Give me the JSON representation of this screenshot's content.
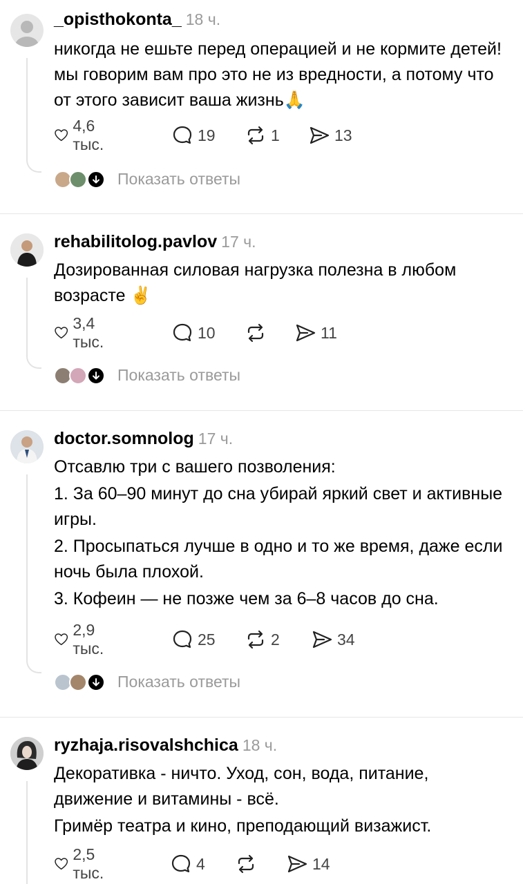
{
  "posts": [
    {
      "username": "_opisthokonta_",
      "time": "18 ч.",
      "paragraphs": [
        "никогда не ешьте перед операцией и не кормите детей! мы говорим вам про это не из вредности, а потому что от этого зависит ваша жизнь🙏"
      ],
      "likes": "4,6 тыс.",
      "comments": "19",
      "reposts": "1",
      "shares": "13",
      "show_replies": "Показать ответы"
    },
    {
      "username": "rehabilitolog.pavlov",
      "time": "17 ч.",
      "paragraphs": [
        "Дозированная силовая нагрузка полезна в любом возрасте ✌️"
      ],
      "likes": "3,4 тыс.",
      "comments": "10",
      "reposts": "",
      "shares": "11",
      "show_replies": "Показать ответы"
    },
    {
      "username": "doctor.somnolog",
      "time": "17 ч.",
      "paragraphs": [
        "Отсавлю три с вашего позволения:",
        "1. За 60–90 минут до сна убирай яркий свет и активные игры.",
        "2. Просыпаться лучше в одно и то же время, даже если ночь была плохой.",
        "3. Кофеин — не позже чем за 6–8 часов до сна."
      ],
      "likes": "2,9 тыс.",
      "comments": "25",
      "reposts": "2",
      "shares": "34",
      "show_replies": "Показать ответы"
    },
    {
      "username": "ryzhaja.risovalshchica",
      "time": "18 ч.",
      "paragraphs": [
        "Декоративка - ничто. Уход, сон, вода, питание, движение и витамины - всё.",
        "Гримёр театра и кино, преподающий визажист."
      ],
      "likes": "2,5 тыс.",
      "comments": "4",
      "reposts": "",
      "shares": "14"
    }
  ],
  "icons": {
    "like": "heart-icon",
    "comment": "comment-icon",
    "repost": "repost-icon",
    "share": "share-icon",
    "expand": "chevron-down-icon"
  }
}
